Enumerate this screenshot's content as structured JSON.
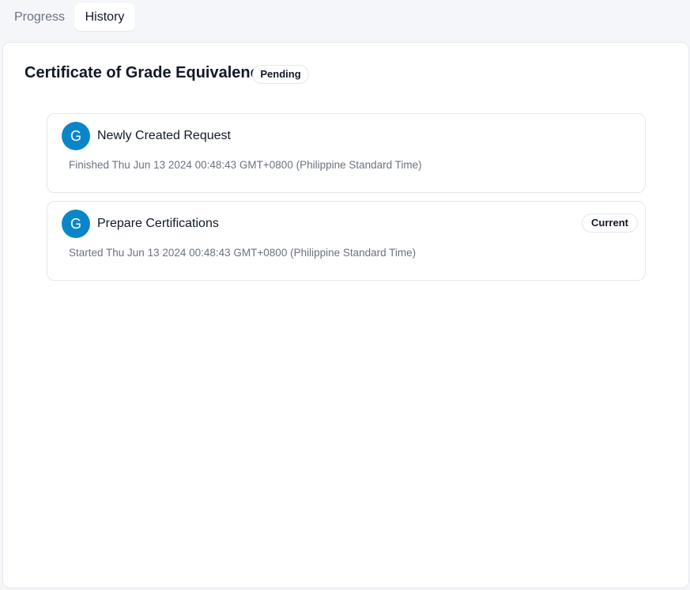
{
  "tabs": [
    {
      "label": "Progress",
      "active": false
    },
    {
      "label": "History",
      "active": true
    }
  ],
  "header": {
    "title": "Certificate of Grade Equivalence",
    "status": "Pending"
  },
  "history": [
    {
      "avatar_initial": "G",
      "title": "Newly Created Request",
      "time": "Finished Thu Jun 13 2024 00:48:43 GMT+0800 (Philippine Standard Time)",
      "badge": null
    },
    {
      "avatar_initial": "G",
      "title": "Prepare Certifications",
      "time": "Started Thu Jun 13 2024 00:48:43 GMT+0800 (Philippine Standard Time)",
      "badge": "Current"
    }
  ],
  "colors": {
    "avatar": "#0a86c8",
    "background": "#f4f6f9",
    "muted_text": "#6b7280"
  }
}
